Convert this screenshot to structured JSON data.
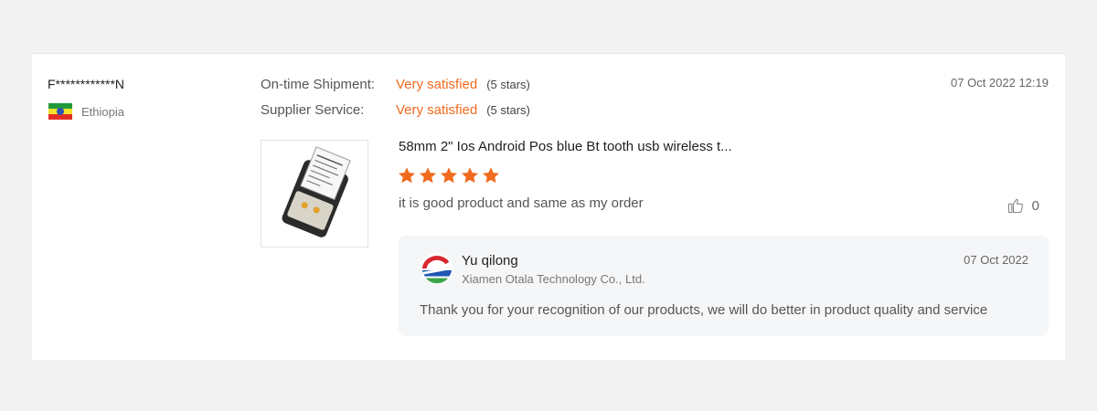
{
  "review": {
    "buyer_name": "F************N",
    "country": "Ethiopia",
    "flag_icon": "ethiopia-flag-icon",
    "date": "07 Oct 2022 12:19",
    "ratings": [
      {
        "label": "On-time Shipment:",
        "value": "Very satisfied",
        "stars": "(5 stars)"
      },
      {
        "label": "Supplier Service:",
        "value": "Very satisfied",
        "stars": "(5 stars)"
      }
    ],
    "product_title": "58mm 2\" Ios Android Pos blue Bt tooth usb wireless t...",
    "star_rating": 5,
    "text": "it is good product and same as my order",
    "like_count": "0",
    "accent_color": "#f16a1d"
  },
  "reply": {
    "name": "Yu qilong",
    "company": "Xiamen Otala Technology Co., Ltd.",
    "date": "07 Oct 2022",
    "text": "Thank you for your recognition of our products, we will do better in product quality and service"
  }
}
